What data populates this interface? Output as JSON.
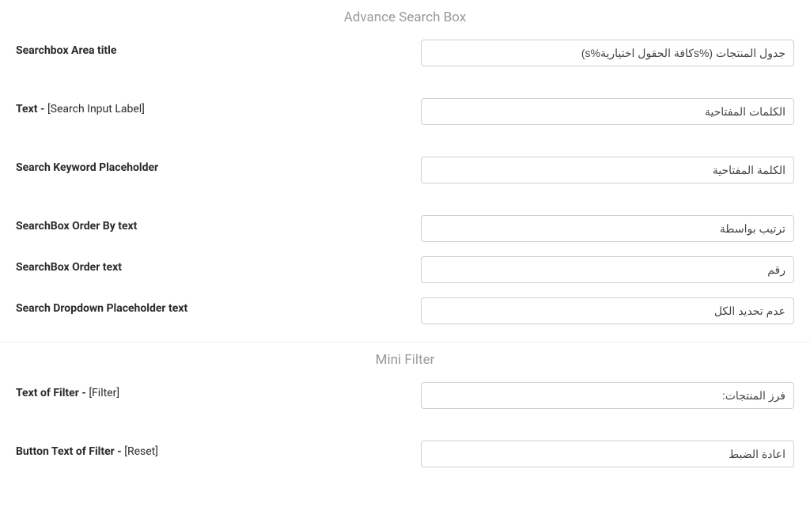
{
  "sections": {
    "advance_search": {
      "heading": "Advance Search Box",
      "fields": {
        "area_title": {
          "label": "Searchbox Area title",
          "value": "جدول المنتجات (%sكافة الحقول اختيارية%s)"
        },
        "input_label": {
          "label_main": "Text - ",
          "label_sub": "[Search Input Label]",
          "value": "الكلمات المفتاحية"
        },
        "keyword_placeholder": {
          "label": "Search Keyword Placeholder",
          "value": "الكلمة المفتاحية"
        },
        "order_by": {
          "label": "SearchBox Order By text",
          "value": "ترتيب بواسطة"
        },
        "order": {
          "label": "SearchBox Order text",
          "value": "رقم"
        },
        "dropdown_placeholder": {
          "label": "Search Dropdown Placeholder text",
          "value": "عدم تحديد الكل"
        }
      }
    },
    "mini_filter": {
      "heading": "Mini Filter",
      "fields": {
        "text_of_filter": {
          "label_main": "Text of Filter - ",
          "label_sub": "[Filter]",
          "value": "فرز المنتجات:"
        },
        "button_text": {
          "label_main": "Button Text of Filter - ",
          "label_sub": "[Reset]",
          "value": "اعادة الضبط"
        }
      }
    }
  }
}
